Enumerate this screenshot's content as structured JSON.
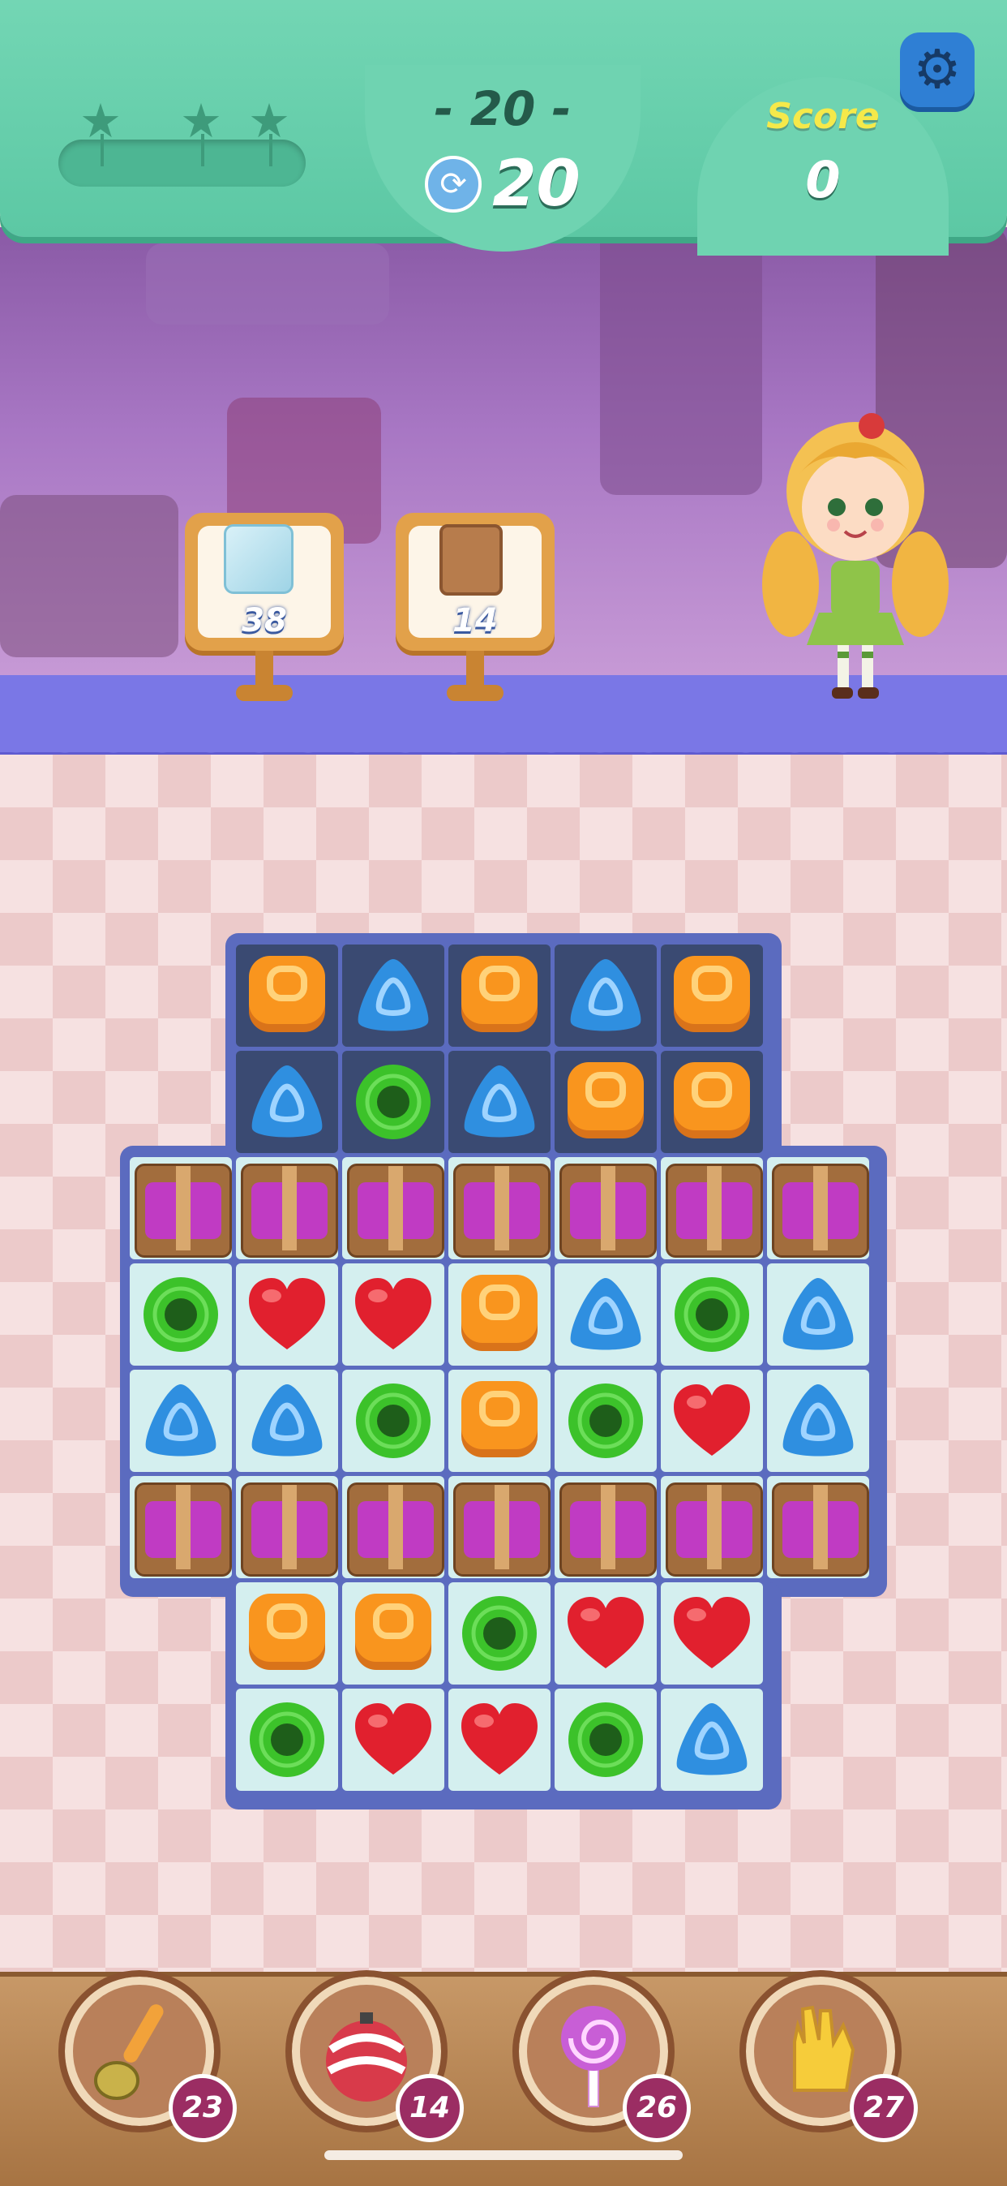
{
  "hud": {
    "level_label": "- 20 -",
    "moves_left": "20",
    "score_label": "Score",
    "score_value": "0",
    "stars_earned": 0,
    "stars_total": 3,
    "progress_fraction": 0
  },
  "goals": [
    {
      "icon": "ice-block-icon",
      "count": "38"
    },
    {
      "icon": "wooden-crate-icon",
      "count": "14"
    }
  ],
  "colors": {
    "orange": "#f9951e",
    "blue": "#2f8fe0",
    "green": "#3cc22a",
    "red": "#e1202e",
    "hud_green": "#5cc8a4",
    "booster_badge": "#9b2d63"
  },
  "board": {
    "rows": [
      [
        null,
        "orange",
        "blue",
        "orange",
        "blue",
        "orange",
        null
      ],
      [
        null,
        "blue",
        "green",
        "blue",
        "orange",
        "orange",
        null
      ],
      [
        "crate",
        "crate",
        "crate",
        "crate",
        "crate",
        "crate",
        "crate"
      ],
      [
        "green",
        "red",
        "red",
        "orange",
        "blue",
        "green",
        "blue"
      ],
      [
        "blue",
        "blue",
        "green",
        "orange",
        "green",
        "red",
        "blue"
      ],
      [
        "crate",
        "crate",
        "crate",
        "crate",
        "crate",
        "crate",
        "crate"
      ],
      [
        null,
        "orange",
        "orange",
        "green",
        "red",
        "red",
        null
      ],
      [
        null,
        "green",
        "red",
        "red",
        "green",
        "blue",
        null
      ]
    ],
    "dark_rows": [
      0,
      1
    ]
  },
  "boosters": [
    {
      "icon": "spoon-icon",
      "count": "23"
    },
    {
      "icon": "bomb-icon",
      "count": "14"
    },
    {
      "icon": "lollipop-icon",
      "count": "26"
    },
    {
      "icon": "glove-icon",
      "count": "27"
    }
  ]
}
